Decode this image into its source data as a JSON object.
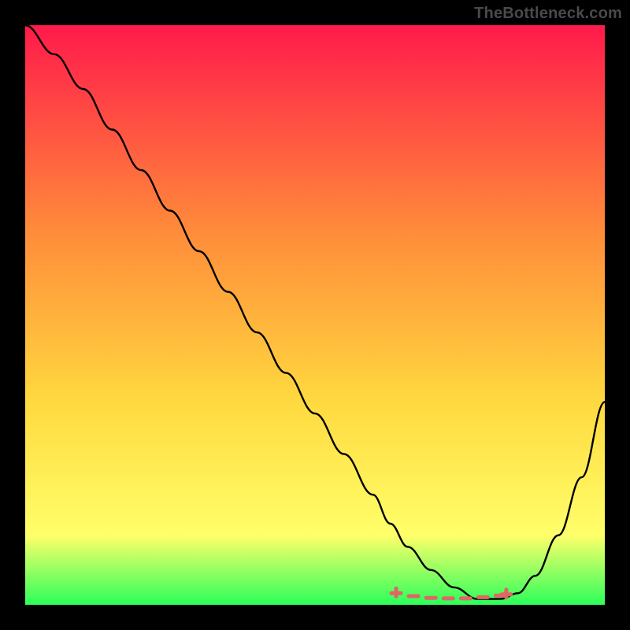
{
  "watermark": "TheBottleneck.com",
  "colors": {
    "gradient_top": "#ff1a4b",
    "gradient_mid1": "#ff8a3a",
    "gradient_mid2": "#ffd93f",
    "gradient_mid3": "#ffff6a",
    "gradient_bottom": "#2bff5a",
    "frame": "#000000",
    "curve": "#000000",
    "marker": "#e06666"
  },
  "chart_data": {
    "type": "line",
    "title": "",
    "xlabel": "",
    "ylabel": "",
    "xlim": [
      0,
      100
    ],
    "ylim": [
      0,
      100
    ],
    "series": [
      {
        "name": "bottleneck-curve",
        "x": [
          0,
          5,
          10,
          15,
          20,
          25,
          30,
          35,
          40,
          45,
          50,
          55,
          60,
          63,
          66,
          70,
          74,
          78,
          82,
          85,
          88,
          92,
          96,
          100
        ],
        "y": [
          100,
          95,
          89,
          82,
          75,
          68,
          61,
          54,
          47,
          40,
          33,
          26,
          19,
          14,
          10,
          6,
          3,
          1,
          1,
          2,
          5,
          12,
          22,
          35
        ]
      },
      {
        "name": "optimal-zone-markers",
        "x": [
          64,
          67,
          70,
          73,
          76,
          79,
          82,
          83
        ],
        "y": [
          2,
          1.5,
          1.2,
          1.1,
          1.1,
          1.3,
          1.6,
          1.8
        ]
      }
    ],
    "annotations": []
  }
}
